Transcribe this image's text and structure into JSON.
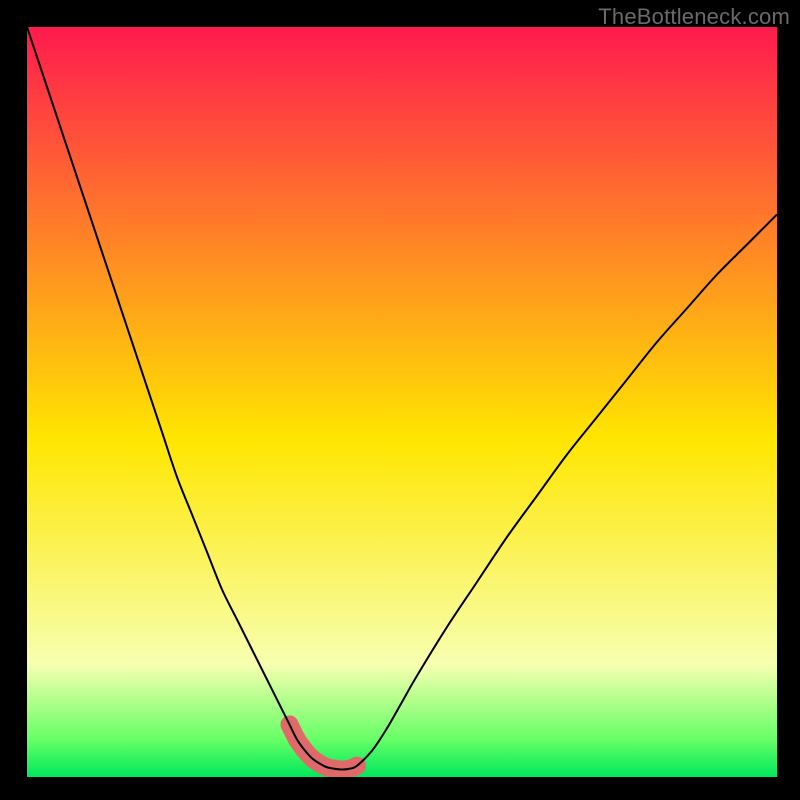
{
  "watermark": {
    "text": "TheBottleneck.com"
  },
  "colors": {
    "black": "#000000",
    "curve_stroke": "#000000",
    "marker_fill": "#e06a6a",
    "gradient_top": "#ff1a4f",
    "gradient_yellow": "#ffe600",
    "gradient_pale": "#f7ffb0",
    "gradient_green_light": "#66ff66",
    "gradient_green": "#00e85c"
  },
  "chart_data": {
    "type": "line",
    "title": "",
    "xlabel": "",
    "ylabel": "",
    "xlim": [
      0,
      100
    ],
    "ylim": [
      0,
      100
    ],
    "x": [
      0,
      2,
      4,
      6,
      8,
      10,
      12,
      14,
      16,
      18,
      20,
      22,
      24,
      26,
      28,
      30,
      32,
      34,
      35,
      36,
      37,
      38,
      39,
      40,
      41,
      42,
      43,
      44,
      46,
      48,
      50,
      52,
      56,
      60,
      64,
      68,
      72,
      76,
      80,
      84,
      88,
      92,
      96,
      100
    ],
    "values": [
      100,
      94,
      88,
      82,
      76,
      70,
      64,
      58,
      52,
      46,
      40,
      35,
      30,
      25,
      21,
      17,
      13,
      9,
      7,
      5,
      3.6,
      2.5,
      1.8,
      1.3,
      1.1,
      1.0,
      1.1,
      1.5,
      3.5,
      6.5,
      10,
      13.5,
      20,
      26,
      32,
      37.5,
      43,
      48,
      53,
      58,
      62.5,
      67,
      71,
      75
    ],
    "min_region_x": [
      35,
      36,
      37,
      38,
      39,
      40,
      41,
      42,
      43,
      44
    ],
    "min_region_y": [
      7,
      5,
      3.6,
      2.5,
      1.8,
      1.3,
      1.1,
      1.0,
      1.1,
      1.5
    ]
  }
}
